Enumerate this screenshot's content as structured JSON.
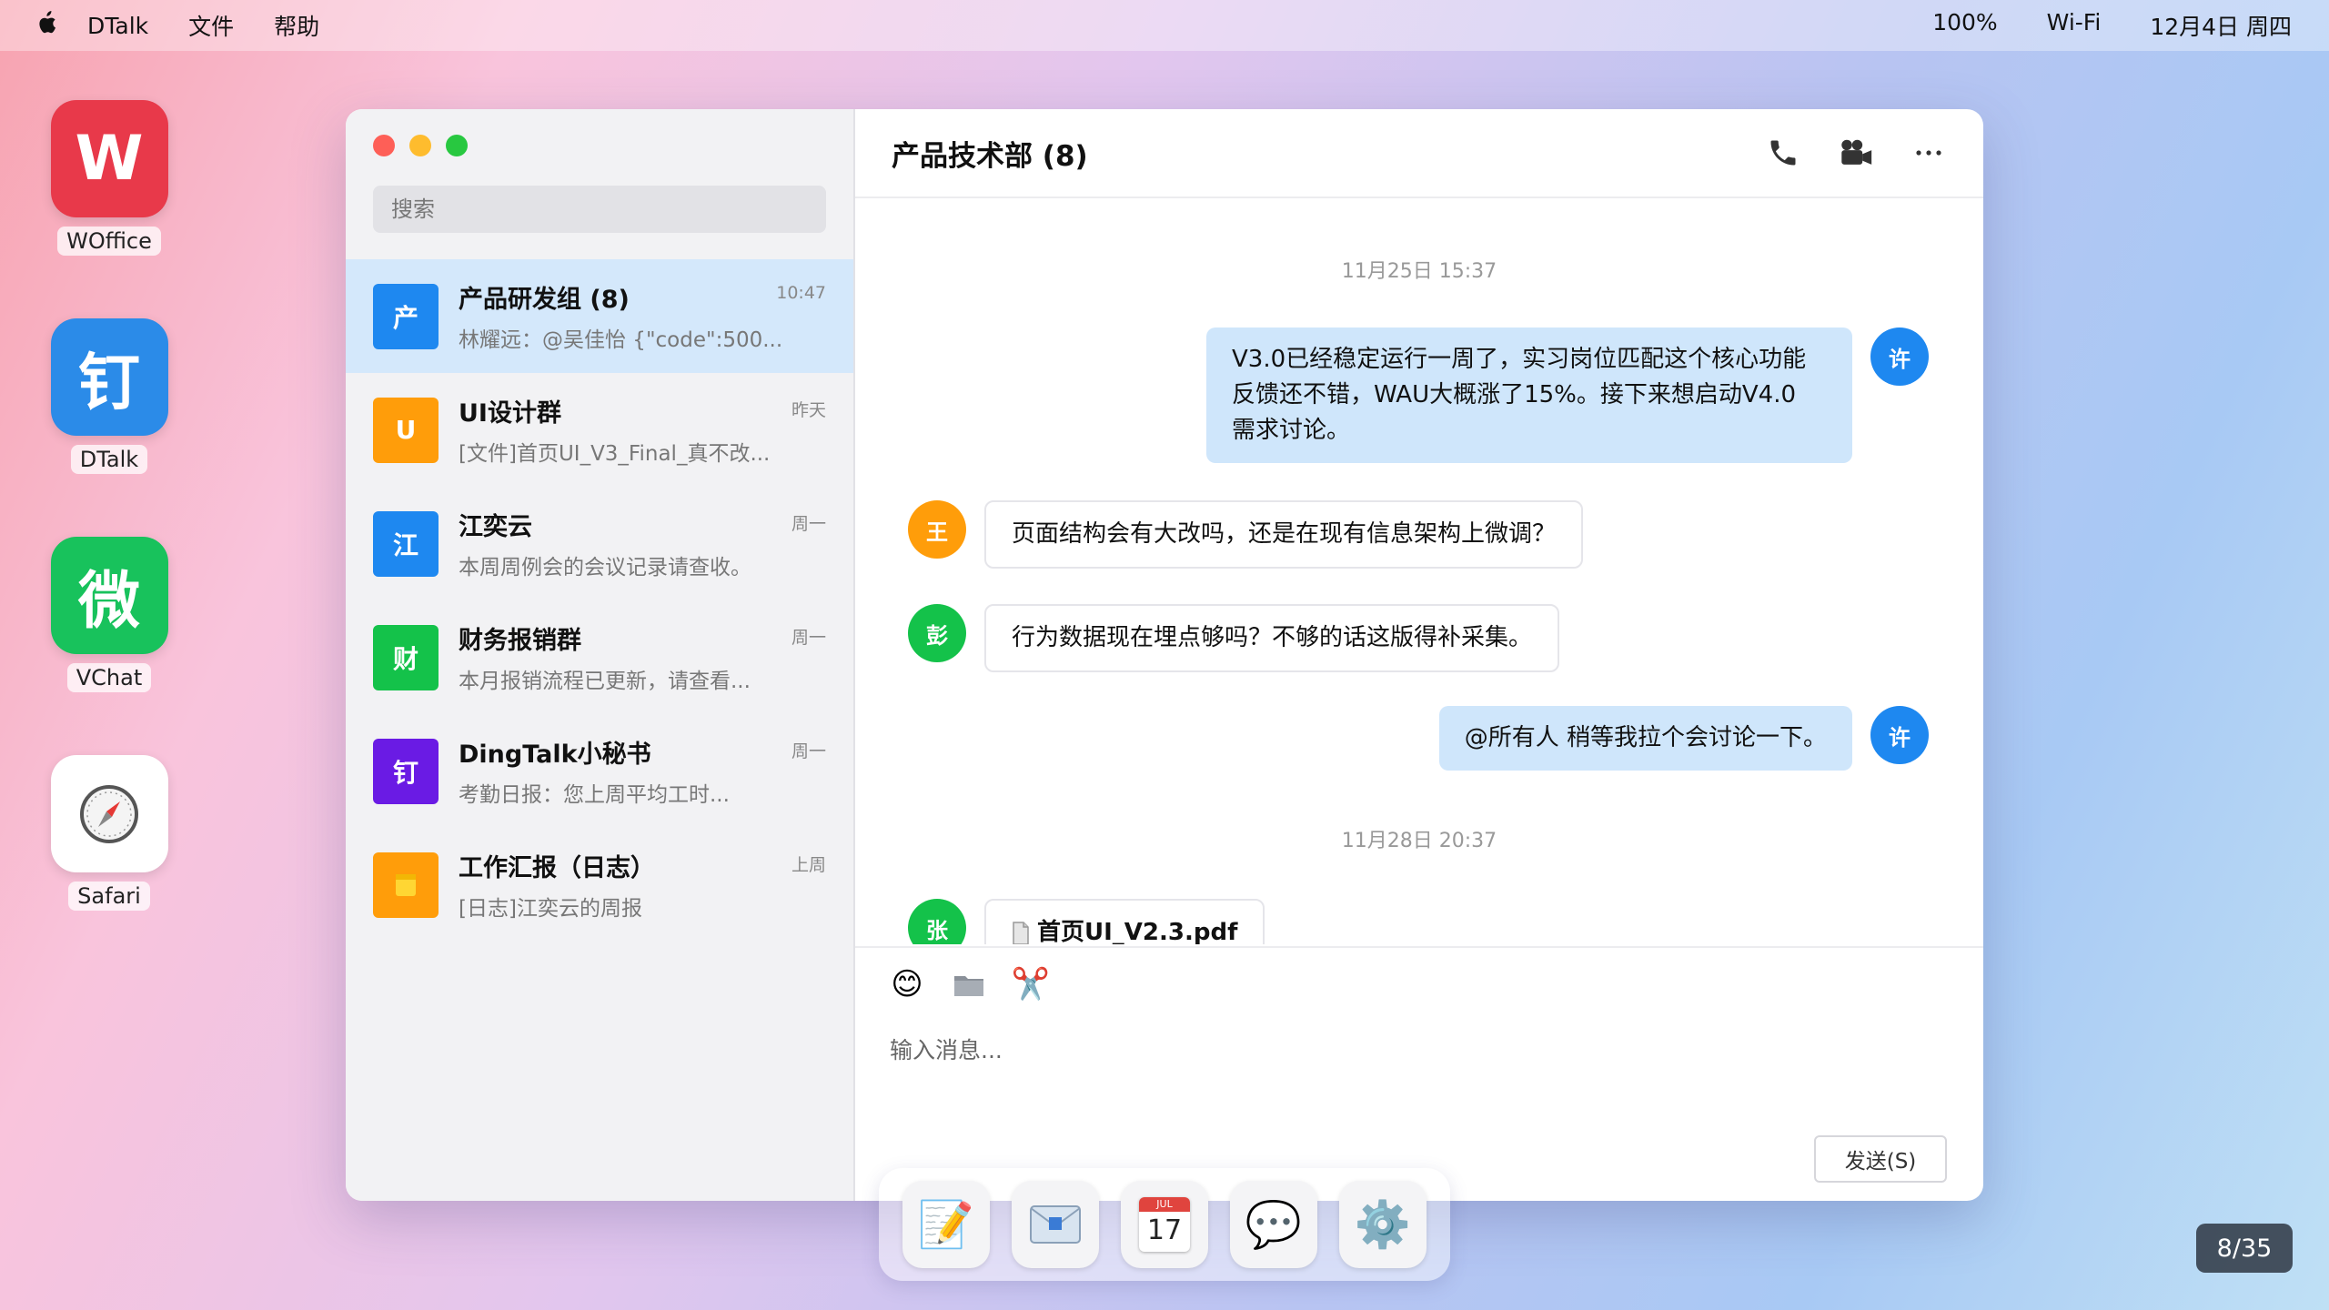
{
  "menubar": {
    "app_name": "DTalk",
    "menus": [
      "文件",
      "帮助"
    ],
    "battery": "100%",
    "wifi": "Wi-Fi",
    "datetime": "12月4日 周四"
  },
  "desktop": [
    {
      "glyph": "W",
      "label": "WOffice",
      "color": "#e8394a"
    },
    {
      "glyph": "钉",
      "label": "DTalk",
      "color": "#2b8be8"
    },
    {
      "glyph": "微",
      "label": "VChat",
      "color": "#18c25c"
    },
    {
      "glyph": "compass-icon",
      "label": "Safari",
      "color": "#ffffff"
    }
  ],
  "sidebar": {
    "search_placeholder": "搜索",
    "conversations": [
      {
        "avatar": "产",
        "color": "#1e88f0",
        "name": "产品研发组 (8)",
        "preview": "林耀远：@吴佳怡 {\"code\":500...",
        "time": "10:47",
        "active": true
      },
      {
        "avatar": "U",
        "color": "#ff9d0a",
        "name": "UI设计群",
        "preview": "[文件]首页UI_V3_Final_真不改...",
        "time": "昨天"
      },
      {
        "avatar": "江",
        "color": "#1e88f0",
        "name": "江奕云",
        "preview": "本周周例会的会议记录请查收。",
        "time": "周一"
      },
      {
        "avatar": "财",
        "color": "#14c24a",
        "name": "财务报销群",
        "preview": "本月报销流程已更新，请查看...",
        "time": "周一"
      },
      {
        "avatar": "钉",
        "color": "#6a1be4",
        "name": "DingTalk小秘书",
        "preview": "考勤日报：您上周平均工时...",
        "time": "周一"
      },
      {
        "avatar": "note-icon",
        "color": "#ff9d0a",
        "name": "工作汇报（日志）",
        "preview": "[日志]江奕云的周报",
        "time": "上周"
      }
    ]
  },
  "chat": {
    "title": "产品技术部 (8)",
    "actions": [
      "phone-icon",
      "video-camera-icon",
      "more-icon"
    ],
    "messages": [
      {
        "type": "time",
        "text": "11月25日 15:37"
      },
      {
        "type": "out",
        "avatar": "许",
        "color": "#1e88f0",
        "text": "V3.0已经稳定运行一周了，实习岗位匹配这个核心功能反馈还不错，WAU大概涨了15%。接下来想启动V4.0 需求讨论。"
      },
      {
        "type": "in",
        "avatar": "王",
        "color": "#ff9d0a",
        "text": "页面结构会有大改吗，还是在现有信息架构上微调？"
      },
      {
        "type": "in",
        "avatar": "彭",
        "color": "#14c24a",
        "text": "行为数据现在埋点够吗？不够的话这版得补采集。"
      },
      {
        "type": "out",
        "avatar": "许",
        "color": "#1e88f0",
        "text": "@所有人 稍等我拉个会讨论一下。"
      },
      {
        "type": "time",
        "text": "11月28日 20:37"
      },
      {
        "type": "file",
        "avatar": "张",
        "color": "#14c24a",
        "text": "首页UI_V2.3.pdf"
      }
    ],
    "input_placeholder": "输入消息...",
    "send_label": "发送(S)",
    "tools": [
      "emoji-icon",
      "folder-icon",
      "scissors-icon"
    ]
  },
  "dock": [
    "notes-icon",
    "mail-icon",
    "calendar-icon",
    "messages-icon",
    "settings-icon"
  ],
  "calendar_day": "17",
  "calendar_month": "JUL",
  "page_indicator": "8/35"
}
